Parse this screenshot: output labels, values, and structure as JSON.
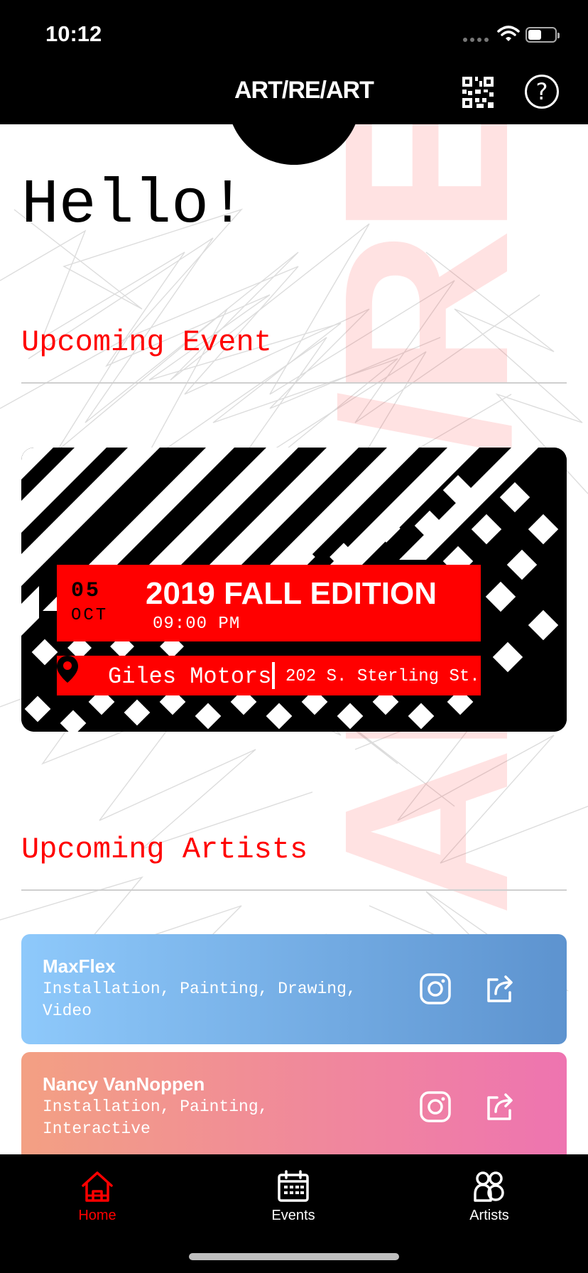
{
  "status_bar": {
    "time": "10:12"
  },
  "header": {
    "logo": "ART/RE/ART"
  },
  "home": {
    "greeting": "Hello!",
    "upcoming_event_title": "Upcoming Event",
    "upcoming_artists_title": "Upcoming Artists",
    "watermark": "ART/RE/ART"
  },
  "event": {
    "day": "05",
    "month": "OCT",
    "title": "2019 FALL EDITION",
    "time": "09:00 PM",
    "venue": "Giles Motors",
    "address": "202 S. Sterling St."
  },
  "artists": [
    {
      "name": "MaxFlex",
      "tags": "Installation, Painting, Drawing, Video"
    },
    {
      "name": "Nancy VanNoppen",
      "tags": "Installation, Painting, Interactive"
    }
  ],
  "tabs": [
    {
      "label": "Home",
      "icon": "home-icon",
      "active": true
    },
    {
      "label": "Events",
      "icon": "calendar-icon",
      "active": false
    },
    {
      "label": "Artists",
      "icon": "people-icon",
      "active": false
    }
  ],
  "colors": {
    "accent": "#ff0000",
    "card_blue_start": "#8ec9fb",
    "card_blue_end": "#5d93cf",
    "card_pink_start": "#f3a083",
    "card_pink_end": "#ee74b0"
  }
}
